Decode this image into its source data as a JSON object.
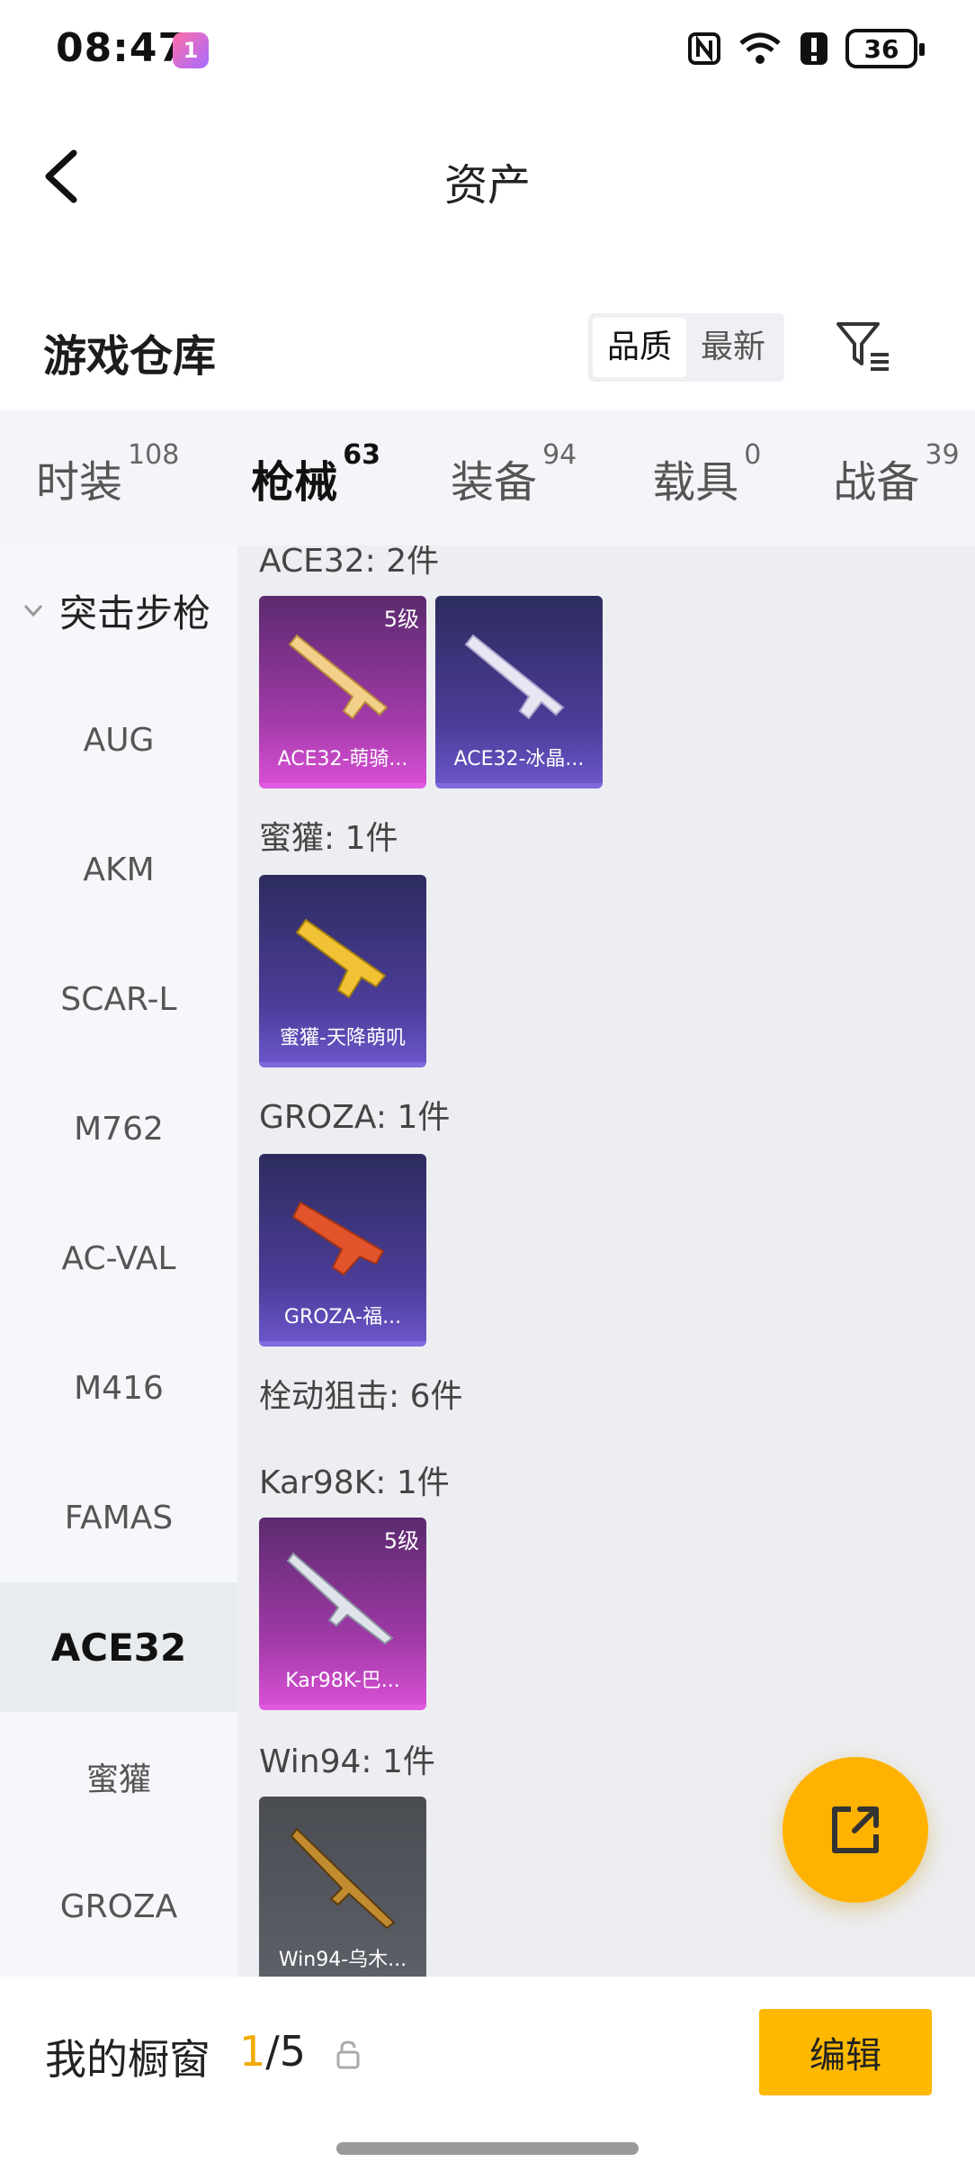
{
  "status_bar": {
    "time": "08:47",
    "app_badge": "1",
    "battery": "36"
  },
  "header": {
    "title": "资产"
  },
  "section": {
    "title": "游戏仓库",
    "sort_options": [
      "品质",
      "最新"
    ],
    "sort_selected": "品质"
  },
  "tabs": [
    {
      "label": "时装",
      "count": "108"
    },
    {
      "label": "枪械",
      "count": "63",
      "active": true
    },
    {
      "label": "装备",
      "count": "94"
    },
    {
      "label": "载具",
      "count": "0"
    },
    {
      "label": "战备",
      "count": "39"
    }
  ],
  "sidebar": {
    "group": "突击步枪",
    "items": [
      "AUG",
      "AKM",
      "SCAR-L",
      "M762",
      "AC-VAL",
      "M416",
      "FAMAS",
      "ACE32",
      "蜜獾",
      "GROZA"
    ],
    "active": "ACE32"
  },
  "content": {
    "groups": [
      {
        "label": "ACE32: 2件",
        "cards": [
          {
            "name": "ACE32-萌骑...",
            "level": "5级",
            "style": "pink"
          },
          {
            "name": "ACE32-冰晶...",
            "level": "",
            "style": "purple"
          }
        ]
      },
      {
        "label": "蜜獾: 1件",
        "cards": [
          {
            "name": "蜜獾-天降萌叽",
            "level": "",
            "style": "purple"
          }
        ]
      },
      {
        "label": "GROZA: 1件",
        "cards": [
          {
            "name": "GROZA-福...",
            "level": "",
            "style": "purple"
          }
        ]
      },
      {
        "label": "栓动狙击: 6件",
        "cards": []
      },
      {
        "label": "Kar98K: 1件",
        "cards": [
          {
            "name": "Kar98K-巴...",
            "level": "5级",
            "style": "pink"
          }
        ]
      },
      {
        "label": "Win94: 1件",
        "cards": [
          {
            "name": "Win94-乌木...",
            "level": "",
            "style": "gray"
          }
        ]
      }
    ]
  },
  "bottom_bar": {
    "label": "我的橱窗",
    "count_current": "1",
    "count_total": "/5",
    "edit_label": "编辑"
  },
  "colors": {
    "accent": "#ffb800",
    "pink_rarity": "#d64fd3",
    "purple_rarity": "#6b55c8"
  }
}
